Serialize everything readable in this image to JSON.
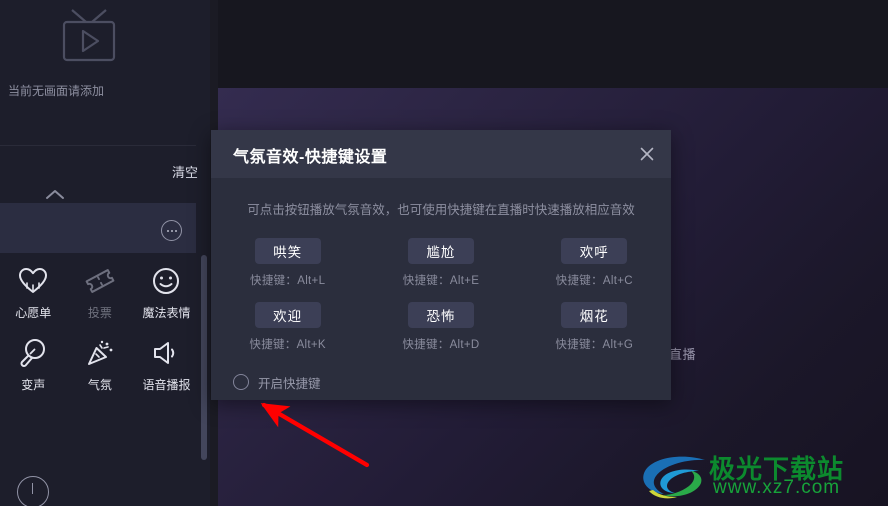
{
  "sidebar": {
    "preview": {
      "icon": "tv-play-icon",
      "empty_text": "当前无画面请添加"
    },
    "clear_label": "清空",
    "collapse_icon": "chevron-up-icon",
    "more_icon": "more-dots-icon",
    "tools": [
      {
        "label": "心愿单",
        "icon": "heart-icon",
        "dim": false
      },
      {
        "label": "投票",
        "icon": "ticket-icon",
        "dim": true
      },
      {
        "label": "魔法表情",
        "icon": "smiley-face-icon",
        "dim": false
      },
      {
        "label": "变声",
        "icon": "microphone-icon",
        "dim": false
      },
      {
        "label": "气氛",
        "icon": "party-popper-icon",
        "dim": false
      },
      {
        "label": "语音播报",
        "icon": "speaker-icon",
        "dim": false
      }
    ]
  },
  "stage": {
    "live_label": "直播"
  },
  "modal": {
    "title": "气氛音效-快捷键设置",
    "close_icon": "close-icon",
    "description": "可点击按钮播放气氛音效，也可使用快捷键在直播时快速播放相应音效",
    "shortcut_prefix": "快捷键：",
    "sounds": [
      {
        "label": "哄笑",
        "shortcut": "快捷键：Alt+L"
      },
      {
        "label": "尴尬",
        "shortcut": "快捷键：Alt+E"
      },
      {
        "label": "欢呼",
        "shortcut": "快捷键：Alt+C"
      },
      {
        "label": "欢迎",
        "shortcut": "快捷键：Alt+K"
      },
      {
        "label": "恐怖",
        "shortcut": "快捷键：Alt+D"
      },
      {
        "label": "烟花",
        "shortcut": "快捷键：Alt+G"
      }
    ],
    "enable": {
      "label": "开启快捷键",
      "checked": false
    }
  },
  "annotation": {
    "arrow_color": "#ff0000",
    "arrow_icon": "red-arrow-pointer"
  },
  "watermark": {
    "site_name": "极光下载站",
    "url": "www.xz7.com",
    "logo_icon": "jiguang-swirl-logo"
  },
  "colors": {
    "modal_header": "#343748",
    "modal_body": "#2b2e3d",
    "button_bg": "#3c3f56",
    "sidebar_bg": "#1d1e2b",
    "stage_accent": "#342c50"
  }
}
